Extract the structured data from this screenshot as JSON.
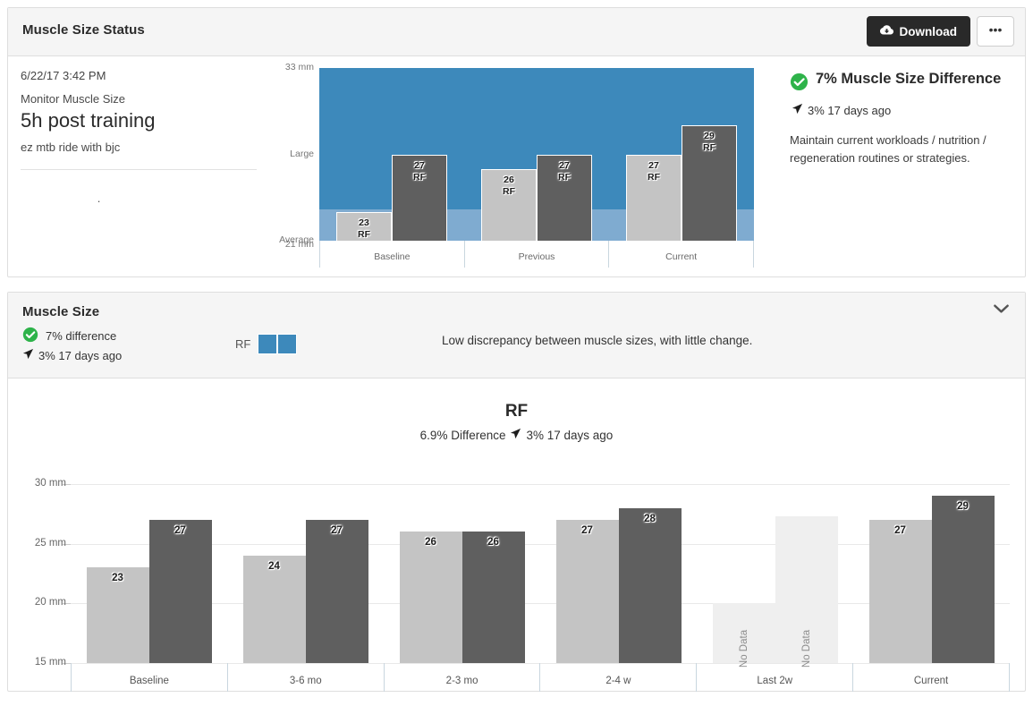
{
  "status_card": {
    "title": "Muscle Size Status",
    "download_label": "Download",
    "download_icon": "cloud-download-icon",
    "more_label": "•••",
    "info": {
      "date": "6/22/17 3:42 PM",
      "subtitle": "Monitor Muscle Size",
      "heading": "5h post training",
      "note": "ez mtb ride with bjc",
      "dot": "."
    },
    "summary": {
      "check_icon": "check-circle-icon",
      "title": "7% Muscle Size Difference",
      "trend_icon": "navigation-arrow-icon",
      "trend": "3% 17 days ago",
      "description": "Maintain current workloads / nutrition / regeneration routines or strategies."
    },
    "colors": {
      "accent_blue": "#3d89bb",
      "band_blue": "#7fabd0",
      "bar_light": "#c4c4c4",
      "bar_dark": "#5f5f5f",
      "ok_green": "#2eb34a",
      "dark_button": "#292929"
    }
  },
  "size_card": {
    "title": "Muscle Size",
    "difference": "7% difference",
    "trend_icon": "navigation-arrow-icon",
    "trend": "3% 17 days ago",
    "check_icon": "check-circle-icon",
    "legend_label": "RF",
    "legend_swatch_count": 2,
    "discrepancy": "Low discrepancy between muscle sizes, with little change.",
    "collapse_icon": "chevron-down-icon"
  },
  "chart_data": [
    {
      "type": "bar",
      "title": "Muscle Size Status",
      "ylabel": "",
      "xlabel": "",
      "ylim": [
        21,
        33
      ],
      "grid": false,
      "ytick_values": [
        33,
        27,
        21
      ],
      "ytick_labels": [
        "33 mm",
        "Large",
        "Average"
      ],
      "extra_ytick_label": "21 mm",
      "categories": [
        "Baseline",
        "Previous",
        "Current"
      ],
      "zones": [
        {
          "name": "Large",
          "from": 23.2,
          "to": 33,
          "color": "#3d89bb"
        },
        {
          "name": "Average",
          "from": 21,
          "to": 23.2,
          "color": "#7fabd0"
        }
      ],
      "series": [
        {
          "name": "RF light",
          "color": "#c4c4c4",
          "values": [
            23,
            26,
            27
          ],
          "unit": "mm",
          "label_suffix": "RF"
        },
        {
          "name": "RF dark",
          "color": "#5f5f5f",
          "values": [
            27,
            27,
            29
          ],
          "unit": "mm",
          "label_suffix": "RF"
        }
      ]
    },
    {
      "type": "bar",
      "title": "RF",
      "subtitle": "6.9% Difference",
      "subtitle_trend_icon": "navigation-arrow-icon",
      "subtitle_trend": "3% 17 days ago",
      "ylabel": "",
      "xlabel": "",
      "ylim": [
        15,
        30
      ],
      "grid": true,
      "ytick_labels": [
        "30 mm",
        "25 mm",
        "20 mm",
        "15 mm"
      ],
      "ytick_values": [
        30,
        25,
        20,
        15
      ],
      "categories": [
        "Baseline",
        "3-6 mo",
        "2-3 mo",
        "2-4 w",
        "Last 2w",
        "Current"
      ],
      "no_data_label": "No Data",
      "series": [
        {
          "name": "RF light",
          "color": "#c4c4c4",
          "values": [
            23,
            24,
            26,
            27,
            null,
            27
          ],
          "no_data_heights": [
            null,
            null,
            null,
            null,
            20,
            null
          ]
        },
        {
          "name": "RF dark",
          "color": "#5f5f5f",
          "values": [
            27,
            27,
            26,
            28,
            null,
            29
          ],
          "no_data_heights": [
            null,
            null,
            null,
            null,
            27.3,
            null
          ]
        }
      ]
    }
  ]
}
